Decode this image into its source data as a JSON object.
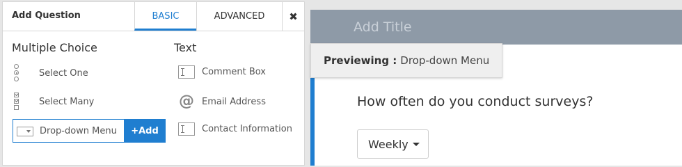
{
  "panel": {
    "title": "Add Question",
    "tabs": [
      "BASIC",
      "ADVANCED"
    ],
    "close_glyph": "✖",
    "columns": {
      "multiple_choice": {
        "heading": "Multiple Choice",
        "items": [
          "Select One",
          "Select Many",
          "Drop-down Menu"
        ]
      },
      "text": {
        "heading": "Text",
        "items": [
          "Comment Box",
          "Email Address",
          "Contact Information"
        ]
      }
    },
    "add_button": "+Add",
    "icons": [
      "radio-icon",
      "checkbox-icon",
      "dropdown-icon",
      "textbox-icon",
      "at-icon",
      "contact-icon"
    ]
  },
  "preview": {
    "title_placeholder": "Add Title",
    "badge_label": "Previewing :",
    "badge_value": "Drop-down Menu",
    "question": "How often do you conduct surveys?",
    "dropdown_value": "Weekly"
  },
  "colors": {
    "accent": "#1f7ed0",
    "title_bar": "#8e9aa7"
  }
}
